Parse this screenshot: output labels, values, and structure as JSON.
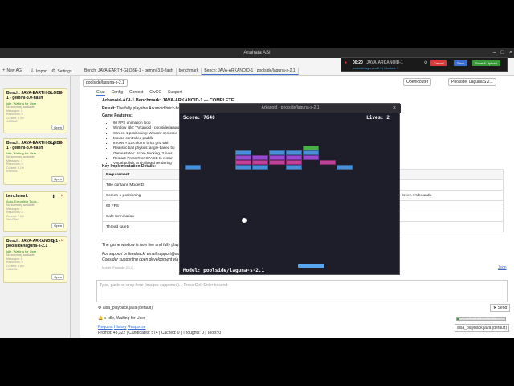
{
  "window": {
    "title": "Anahata ASI"
  },
  "toolbar": {
    "new_agi": "New AGI",
    "import": "Import",
    "settings": "Settings"
  },
  "tabs": [
    {
      "label": "Bench: JAVA-EARTH-GLOBE-1 - gemini-3.0-flash"
    },
    {
      "label": "benchmark"
    },
    {
      "label": "Bench: JAVA-ARKANOID-1 - poolside/laguna-s-2.1"
    }
  ],
  "sessions": [
    {
      "title": "Bench: JAVA-EARTH-GLOBE-1 - gemini-3.0-flash",
      "status": "Idle, Waiting for User",
      "sub": "No summary available",
      "meta": [
        "Messages: 4",
        "Resources: 8",
        "Context: 4.3%"
      ],
      "id": "44f3f6c8",
      "open": "Open"
    },
    {
      "title": "Bench: JAVA-EARTH-GLOBE-1 - gemini-3.0-flash",
      "status": "Idle, Waiting for User",
      "sub": "No summary available",
      "meta": [
        "Messages: 4",
        "Resources: 8",
        "Context: 5.1%"
      ],
      "id": "f2f40d04",
      "open": "Open"
    },
    {
      "title": "benchmark",
      "status": "Auto-Executing Tools...",
      "sub": "No summary available",
      "meta": [
        "Messages: 7",
        "Resources: 8",
        "Context: 7.6%"
      ],
      "id": "3b6475a8",
      "open": "Open"
    },
    {
      "title": "Bench: JAVA-ARKANOID-1 - poolside/laguna-s-2.1",
      "status": "Idle, Waiting for User",
      "sub": "No summary available",
      "meta": [
        "Messages: 6",
        "Resources: 8",
        "Context: 4.8%"
      ],
      "id": "f4b6b3f1",
      "open": "Open"
    }
  ],
  "session_chip": "poolside/laguna-s-2.1",
  "subtabs": [
    "Chat",
    "Config",
    "Context",
    "CwGC",
    "Support"
  ],
  "provider": {
    "label": "OpenRouter",
    "model": "Poolside: Laguna S 2.1"
  },
  "content": {
    "heading": "Arkanoid-AGI-1 Benchmark: JAVA-ARKANOID-1 — COMPLETE",
    "result_label": "Result:",
    "result_text": "The fully playable Arkanoid brick-brea",
    "features_label": "Game Features:",
    "features": [
      "60 FPS animation loop",
      "Window title: \"Arkanoid - poolside/laguna-s-",
      "Screen 1 positioning: Window centered",
      "Mouse-controlled paddle",
      "6 rows × 12-column brick grid with",
      "Realistic ball physics: angle-based bo",
      "Game states: Score tracking, 3 lives",
      "Restart: Press R or SPACE to restart",
      "Visual polish: Anti-aliased rendering"
    ],
    "impl_label": "Key Implementation Details:",
    "table_header": "Requirement",
    "rows": [
      "Title contains ModelID",
      "Screen 1 positioning",
      "60 FPS",
      "Safe termination",
      "Thread safety"
    ],
    "row_right": "creen 1's bounds",
    "footer1": "The game window is now live and fully playable.",
    "footer2": "For support or feedback, email support@anahata.uno",
    "footer3": "Consider supporting open development via",
    "json_link": "Json",
    "model_footer": "Model: Poolside 2.1.0"
  },
  "game": {
    "title": "Arkanoid - poolside/laguna-s-2.1",
    "score": "Score: 7640",
    "lives": "Lives: 2",
    "model": "Model: poolside/laguna-s-2.1",
    "colors": {
      "blue": "#4a90d9",
      "purple": "#9a4ad0",
      "magenta": "#c0409a",
      "green": "#4ab04a",
      "paddle": "#58a6f0"
    }
  },
  "input": {
    "placeholder": "Type, paste or drop here (images supported)... Press Ctrl+Enter to send"
  },
  "bottom": {
    "file": "alsa_playback.java (default)",
    "status": "Idle, Waiting for User",
    "links": [
      "Request",
      "History",
      "Response"
    ],
    "stats": "Prompt: 43,322 | Candidates: 574 | Cached: 0 | Thoughts: 0 | Tools: 0",
    "send": "Send",
    "right_file": "alsa_playback.java (default)",
    "progress_pct": 4.4,
    "progress_text": "4.4% (43,896 / 1,000,000)"
  },
  "overlay": {
    "time": "00:20",
    "task": "JAVA-ARKANOID-1",
    "sub": "poolside/laguna-s-2.1 | Clocked: 9",
    "cancel": "Cancel",
    "save": "Save",
    "save_upload": "Save & Upload"
  }
}
